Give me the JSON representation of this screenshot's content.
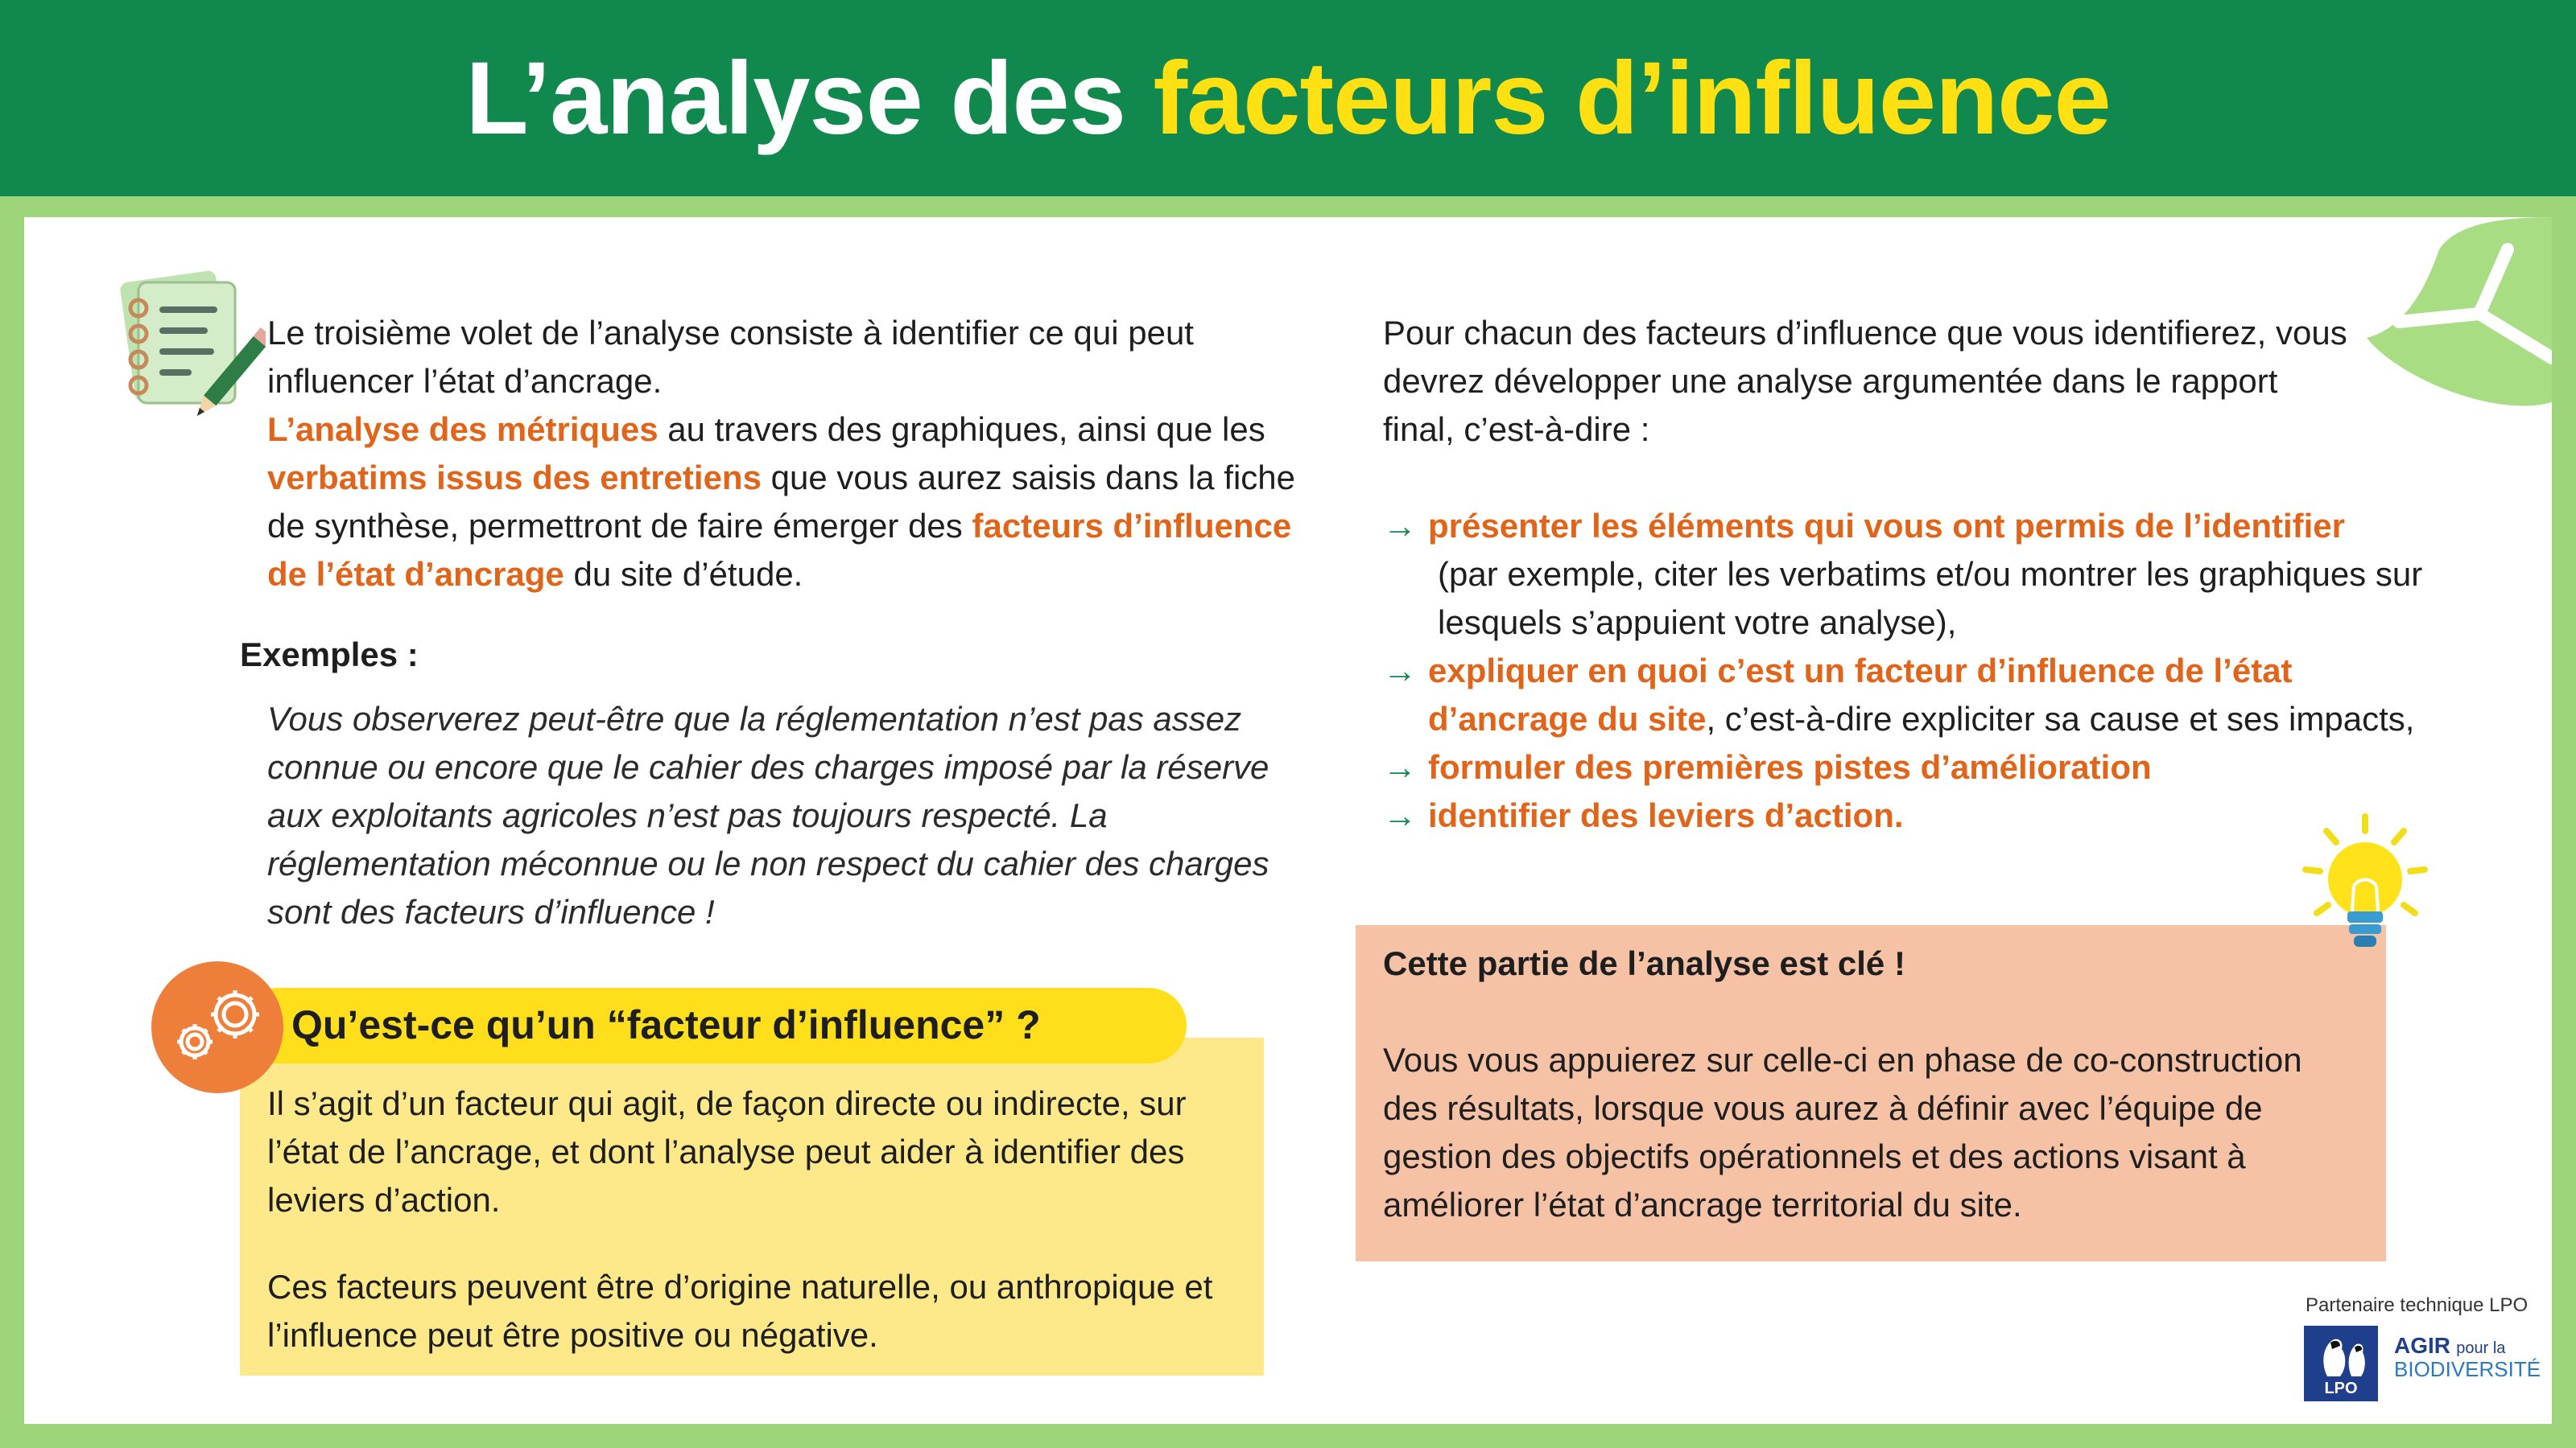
{
  "header": {
    "title_part1": "L’analyse des ",
    "title_part2": "facteurs d’influence"
  },
  "left": {
    "intro": {
      "p1": "Le troisième volet de l’analyse consiste à identifier ce qui peut influencer l’état d’ancrage.",
      "h1": "L’analyse des métriques",
      "p2": " au travers des graphiques, ainsi que les ",
      "h2": "verbatims issus des entretiens",
      "p3": " que vous aurez saisis dans la fiche de synthèse, permettront de faire émerger des ",
      "h3": "facteurs d’influence de l’état d’ancrage",
      "p4": " du  site d’étude."
    },
    "examples_title": "Exemples :",
    "examples_text": "Vous observerez peut-être que la réglementation n’est pas assez connue ou encore que le cahier des charges imposé par la réserve aux exploitants agricoles n’est pas toujours respecté. La réglementation méconnue ou le non respect du cahier des charges sont des facteurs d’influence !",
    "question_title": "Qu’est-ce qu’un “facteur d’influence” ?",
    "definition_1": "Il s’agit d’un facteur qui agit, de façon directe ou indirecte, sur l’état de l’ancrage, et dont l’analyse peut aider à identifier des leviers d’action.",
    "definition_2": "Ces facteurs peuvent être d’origine naturelle, ou anthropique et l’influence peut être positive ou négative."
  },
  "right": {
    "intro": "Pour chacun des facteurs d’influence que vous identifierez, vous devrez développer une analyse argumentée dans le rapport final, c’est-à-dire :",
    "arrow": "→",
    "item1_bold": "présenter les éléments qui vous ont permis de l’identifier",
    "item1_rest": "(par exemple, citer les verbatims et/ou montrer les graphiques sur lesquels s’appuient votre analyse),",
    "item2_bold": "expliquer en quoi c’est un facteur d’influence de l’état d’ancrage du site",
    "item2_rest": ", c’est-à-dire expliciter sa cause et ses impacts,",
    "item3_bold": "formuler des premières pistes d’amélioration",
    "item4_bold": "identifier des leviers d’action.",
    "key_title": "Cette partie de l’analyse est clé !",
    "key_text": "Vous vous appuierez sur celle-ci en phase de co-construction des résultats, lorsque vous aurez à définir avec l’équipe de gestion des objectifs opérationnels et des actions visant à améliorer l’état d’ancrage territorial du site."
  },
  "footer": {
    "partner_label": "Partenaire technique LPO",
    "lpo_logo_text": "LPO",
    "agir_big": "AGIR",
    "agir_small": "pour la",
    "agir_bio": "BIODIVERSITÉ"
  },
  "colors": {
    "header_green": "#11884e",
    "title_yellow": "#ffe012",
    "frame_green": "#9ed57a",
    "highlight_orange": "#e0651a",
    "box_yellow": "#fde98a",
    "box_salmon": "#f6c2a6"
  },
  "icons": [
    "notepad-pencil-icon",
    "gears-icon",
    "lightbulb-icon",
    "leaf-decoration-icon",
    "lpo-bird-logo"
  ]
}
